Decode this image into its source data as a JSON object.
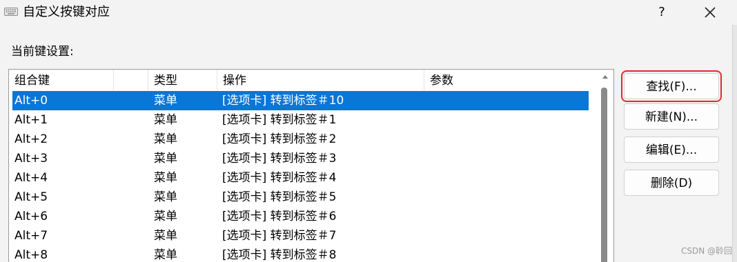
{
  "window": {
    "title": "自定义按键对应",
    "help_label": "?",
    "close_icon": "close-icon",
    "app_icon": "keyboard-icon"
  },
  "section_label": "当前键设置:",
  "table": {
    "columns": [
      "组合键",
      "类型",
      "操作",
      "参数"
    ],
    "rows": [
      {
        "key": "Alt+0",
        "type": "菜单",
        "action": "[选项卡] 转到标签＃10",
        "param": "",
        "selected": true
      },
      {
        "key": "Alt+1",
        "type": "菜单",
        "action": "[选项卡] 转到标签＃1",
        "param": ""
      },
      {
        "key": "Alt+2",
        "type": "菜单",
        "action": "[选项卡] 转到标签＃2",
        "param": ""
      },
      {
        "key": "Alt+3",
        "type": "菜单",
        "action": "[选项卡] 转到标签＃3",
        "param": ""
      },
      {
        "key": "Alt+4",
        "type": "菜单",
        "action": "[选项卡] 转到标签＃4",
        "param": ""
      },
      {
        "key": "Alt+5",
        "type": "菜单",
        "action": "[选项卡] 转到标签＃5",
        "param": ""
      },
      {
        "key": "Alt+6",
        "type": "菜单",
        "action": "[选项卡] 转到标签＃6",
        "param": ""
      },
      {
        "key": "Alt+7",
        "type": "菜单",
        "action": "[选项卡] 转到标签＃7",
        "param": ""
      },
      {
        "key": "Alt+8",
        "type": "菜单",
        "action": "[选项卡] 转到标签＃8",
        "param": ""
      }
    ]
  },
  "buttons": {
    "find": "查找(F)...",
    "new": "新建(N)...",
    "edit": "编辑(E)...",
    "delete": "删除(D)"
  },
  "colors": {
    "selection": "#0a76d6",
    "highlight_frame": "#e3282c"
  },
  "watermark": "CSDN @聆回"
}
